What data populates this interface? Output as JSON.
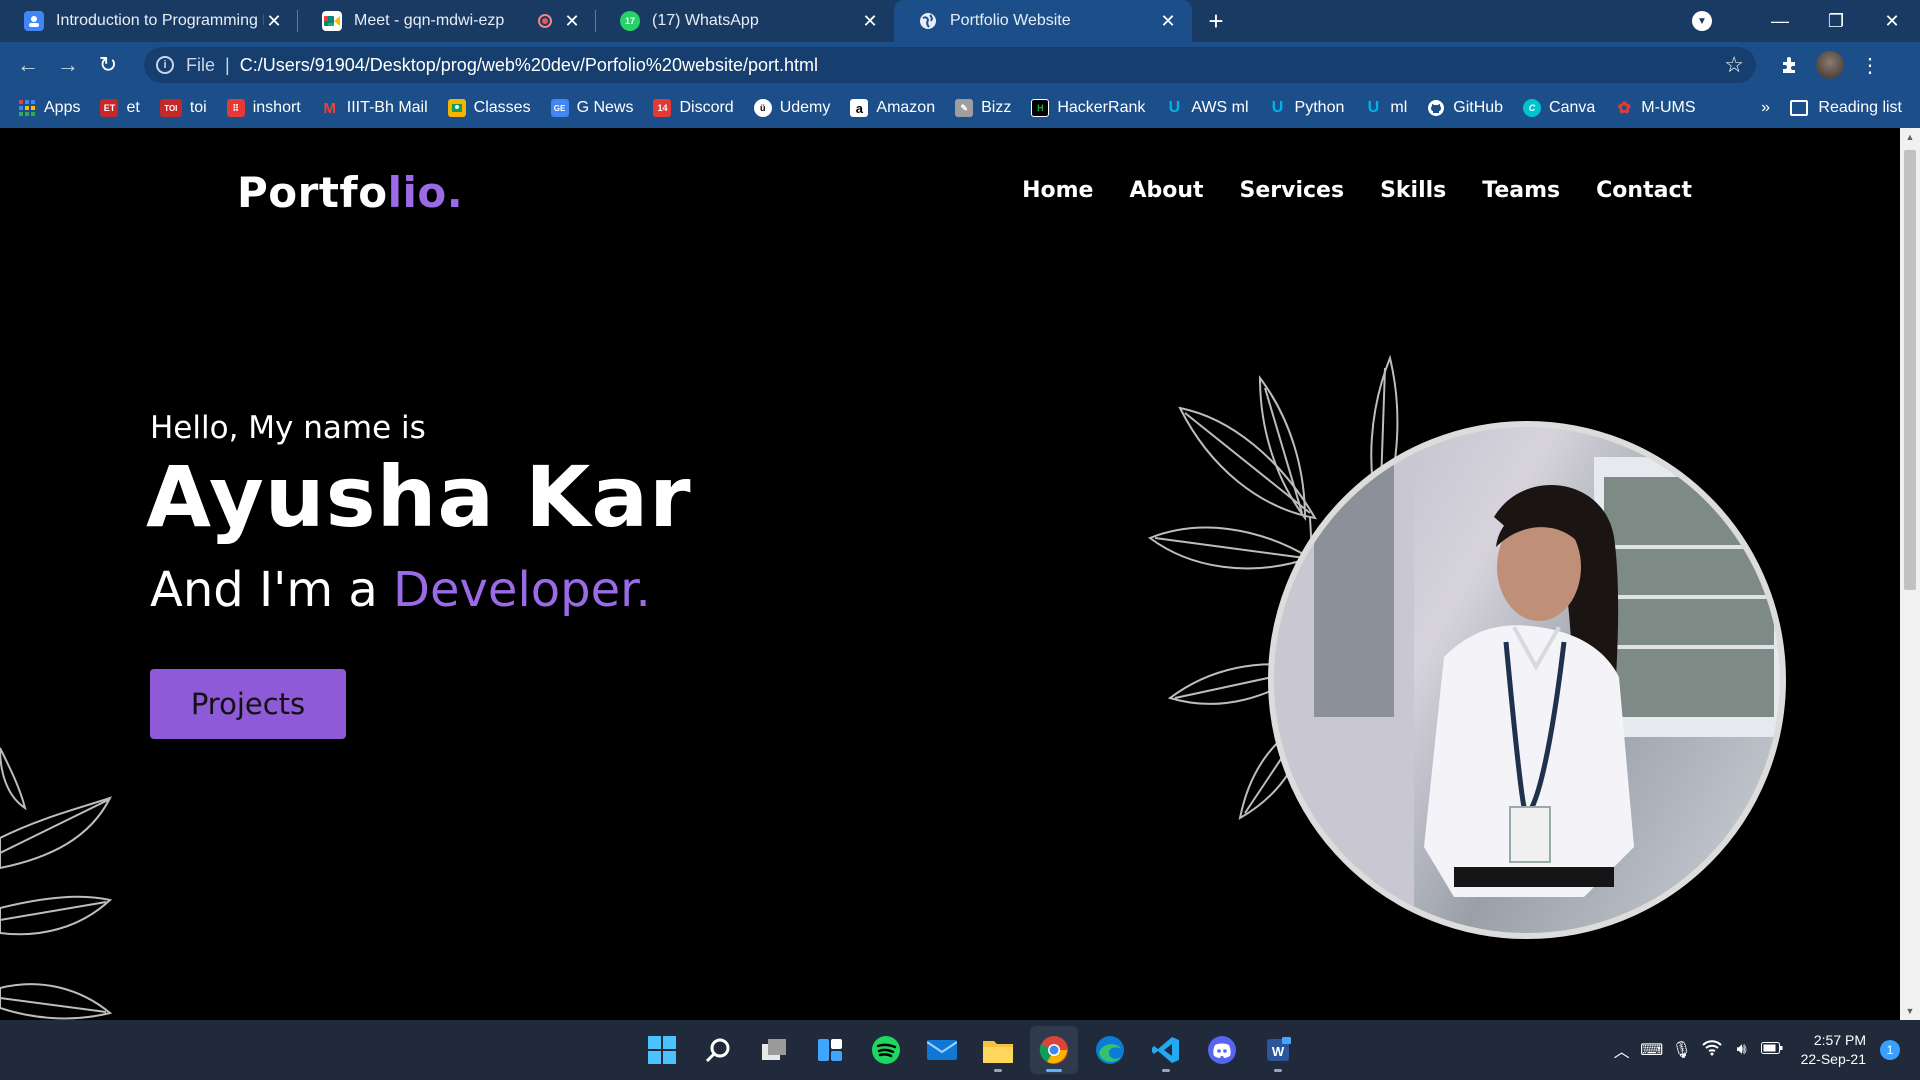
{
  "browser": {
    "tabs": [
      {
        "title": "Introduction to Programming II b",
        "favicon": "classroom-icon",
        "color": "#4285f4",
        "active": false
      },
      {
        "title": "Meet - gqn-mdwi-ezp",
        "favicon": "meet-icon",
        "color": "#00897b",
        "active": false,
        "recording": true
      },
      {
        "title": "(17) WhatsApp",
        "favicon": "whatsapp-icon",
        "color": "#25d366",
        "active": false
      },
      {
        "title": "Portfolio Website",
        "favicon": "globe-icon",
        "color": "#1c4f8a",
        "active": true
      }
    ],
    "new_tab_symbol": "+",
    "window_controls": {
      "minimize": "—",
      "restore": "❐",
      "close": "✕"
    },
    "address": {
      "scheme_label": "File",
      "url": "C:/Users/91904/Desktop/prog/web%20dev/Porfolio%20website/port.html"
    },
    "bookmarks": [
      {
        "label": "Apps",
        "icon": "apps-grid-icon",
        "color": "#4a90e2"
      },
      {
        "label": "et",
        "icon": "et-icon",
        "color": "#c62828"
      },
      {
        "label": "toi",
        "icon": "toi-icon",
        "color": "#c62828"
      },
      {
        "label": "inshort",
        "icon": "inshort-icon",
        "color": "#e53935"
      },
      {
        "label": "IIIT-Bh Mail",
        "icon": "gmail-icon",
        "color": "#ea4335"
      },
      {
        "label": "Classes",
        "icon": "classroom-icon",
        "color": "#f4b400"
      },
      {
        "label": "G News",
        "icon": "gnews-icon",
        "color": "#4285f4"
      },
      {
        "label": "Discord",
        "icon": "discord-icon",
        "color": "#e53935"
      },
      {
        "label": "Udemy",
        "icon": "udemy-icon",
        "color": "#ffffff"
      },
      {
        "label": "Amazon",
        "icon": "amazon-icon",
        "color": "#ffffff"
      },
      {
        "label": "Bizz",
        "icon": "bizz-icon",
        "color": "#9e9e9e"
      },
      {
        "label": "HackerRank",
        "icon": "hackerrank-icon",
        "color": "#000000"
      },
      {
        "label": "AWS ml",
        "icon": "udacity-icon",
        "color": "#02b3e4"
      },
      {
        "label": "Python",
        "icon": "udacity-icon",
        "color": "#02b3e4"
      },
      {
        "label": "ml",
        "icon": "udacity-icon",
        "color": "#02b3e4"
      },
      {
        "label": "GitHub",
        "icon": "github-icon",
        "color": "#ffffff"
      },
      {
        "label": "Canva",
        "icon": "canva-icon",
        "color": "#00c4cc"
      },
      {
        "label": "M-UMS",
        "icon": "mums-icon",
        "color": "#e53935"
      }
    ],
    "bookmarks_more": "»",
    "reading_list": "Reading list"
  },
  "site": {
    "logo": {
      "main": "Portfo",
      "accent": "lio."
    },
    "nav": [
      "Home",
      "About",
      "Services",
      "Skills",
      "Teams",
      "Contact"
    ],
    "hero": {
      "greeting": "Hello, My name is",
      "name": "Ayusha Kar",
      "role_prefix": "And I'm a ",
      "role_accent": "Developer.",
      "button": "Projects"
    },
    "accent_color": "#9b6ae6"
  },
  "taskbar": {
    "apps": [
      "windows-start-icon",
      "search-icon",
      "task-view-icon",
      "widgets-icon",
      "spotify-icon",
      "mail-icon",
      "file-explorer-icon",
      "chrome-icon",
      "edge-icon",
      "vscode-icon",
      "discord-icon",
      "word-icon"
    ],
    "time": "2:57 PM",
    "date": "22-Sep-21",
    "notifications": "1"
  }
}
